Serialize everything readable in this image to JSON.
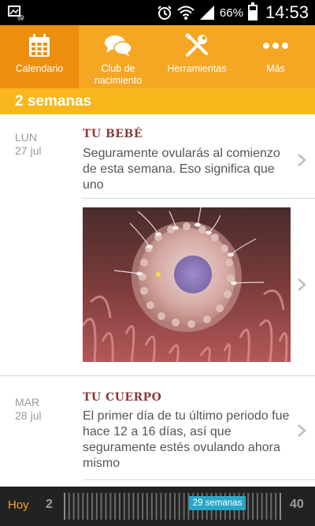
{
  "status_bar": {
    "battery_text": "66%",
    "battery_level": 0.66,
    "time": "14:53",
    "icons": [
      "screenshot-icon",
      "alarm-icon",
      "wifi-icon",
      "signal-icon",
      "battery-icon"
    ]
  },
  "tabs": [
    {
      "label": "Calendario",
      "icon": "calendar-icon",
      "active": true
    },
    {
      "label": "Club de nacimiento",
      "icon": "chat-bubbles-icon",
      "active": false
    },
    {
      "label": "Herramientas",
      "icon": "tools-icon",
      "active": false
    },
    {
      "label": "Más",
      "icon": "more-dots-icon",
      "active": false
    }
  ],
  "week_title": "2 semanas",
  "entries": [
    {
      "day_name": "LUN",
      "date": "27 jul",
      "category": "TU BEBÉ",
      "text": "Seguramente ovularás al comienzo de esta semana. Eso significa que uno"
    },
    {
      "day_name": "MAR",
      "date": "28 jul",
      "category": "TU CUERPO",
      "text": "El primer día de tu último periodo fue hace 12 a 16 días, así que seguramente estés ovulando ahora mismo"
    }
  ],
  "timeline": {
    "today_label": "Hoy",
    "start": "2",
    "end": "40",
    "current_label": "29 semanas"
  },
  "colors": {
    "tab_bar": "#f5a623",
    "tab_active": "#ee8e0f",
    "week_bar": "#f9b71c",
    "category_text": "#8b3a3a",
    "timeline_badge": "#29a6c8",
    "timeline_bg": "#222222"
  }
}
